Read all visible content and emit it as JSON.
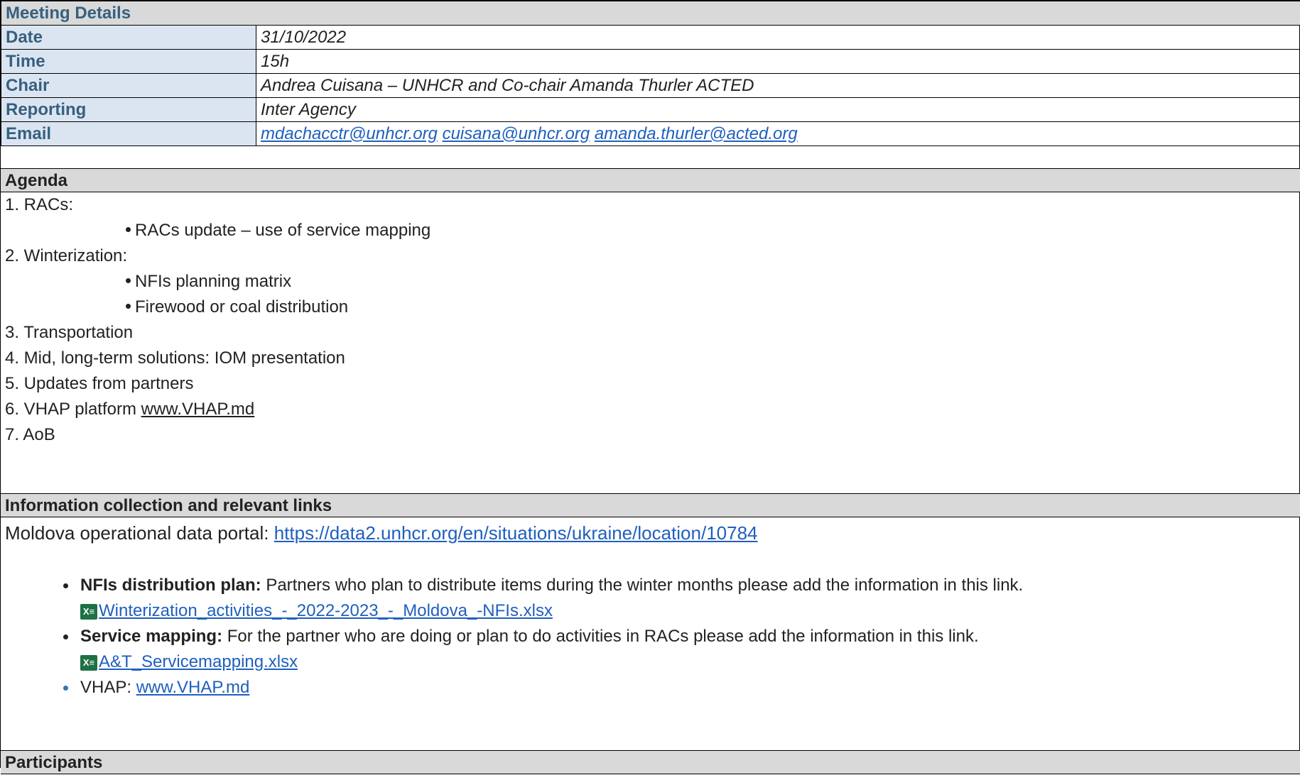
{
  "meeting_details": {
    "header": "Meeting Details",
    "rows": [
      {
        "label": "Date",
        "value": "31/10/2022"
      },
      {
        "label": "Time",
        "value": "15h"
      },
      {
        "label": "Chair",
        "value": "Andrea Cuisana – UNHCR and Co-chair Amanda Thurler ACTED"
      },
      {
        "label": "Reporting",
        "value": "Inter Agency"
      }
    ],
    "email_label": "Email",
    "emails": [
      "mdachacctr@unhcr.org",
      "cuisana@unhcr.org",
      "amanda.thurler@acted.org"
    ]
  },
  "agenda": {
    "header": "Agenda",
    "item1": "1. RACs:",
    "item1_sub1": "RACs update – use of service mapping",
    "item2": "2. Winterization:",
    "item2_sub1": "NFIs planning matrix",
    "item2_sub2": "Firewood or coal distribution",
    "item3": "3. Transportation",
    "item4": "4. Mid, long-term solutions: IOM presentation",
    "item5": "5. Updates from partners",
    "item6_text": "6. VHAP platform ",
    "item6_link": "www.VHAP.md",
    "item7": "7. AoB"
  },
  "info": {
    "header": "Information collection and relevant links",
    "portal_label": "Moldova operational data portal: ",
    "portal_link": "https://data2.unhcr.org/en/situations/ukraine/location/10784",
    "nfi_bold": "NFIs distribution plan:",
    "nfi_text": " Partners who plan to distribute items during the winter months please add the information in this link.",
    "nfi_file": "Winterization_activities_-_2022-2023_-_Moldova_-NFIs.xlsx",
    "svc_bold": "Service mapping:",
    "svc_text": " For the partner who are doing or plan to do activities in RACs please add the information in this link.",
    "svc_file": "A&T_Servicemapping.xlsx",
    "vhap_label": "VHAP: ",
    "vhap_link": "www.VHAP.md",
    "excel_icon_glyph": "X≡"
  },
  "participants": {
    "header": "Participants"
  }
}
